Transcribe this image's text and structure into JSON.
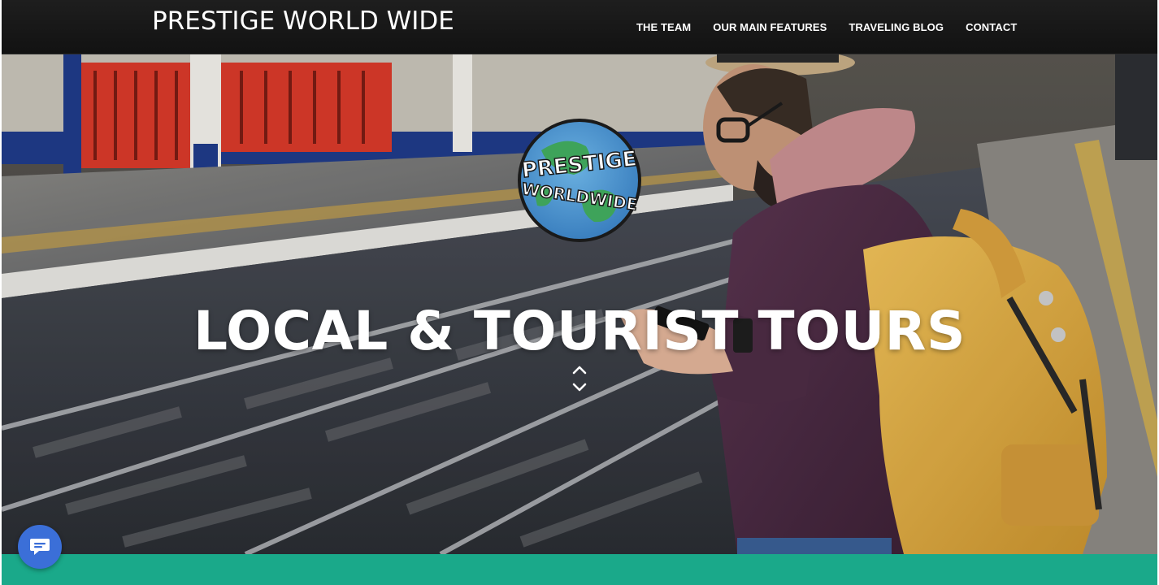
{
  "brand": {
    "title": "PRESTIGE WORLD WIDE"
  },
  "nav": {
    "items": [
      {
        "label": "THE TEAM"
      },
      {
        "label": "OUR MAIN FEATURES"
      },
      {
        "label": "TRAVELING BLOG"
      },
      {
        "label": "CONTACT"
      }
    ]
  },
  "hero": {
    "logo_text_line1": "PRESTIGE",
    "logo_text_line2": "WORLDWIDE",
    "headline": "LOCAL & TOURIST TOURS",
    "scroll_icon": "chevron-up-down-icon"
  },
  "chat": {
    "icon": "chat-bubble-icon"
  },
  "colors": {
    "navbar": "#161616",
    "accent_teal": "#1aa98a",
    "chat_blue": "#3b6fd8",
    "backpack_yellow": "#e4b44a",
    "sweater_purple": "#4a2a3f"
  }
}
